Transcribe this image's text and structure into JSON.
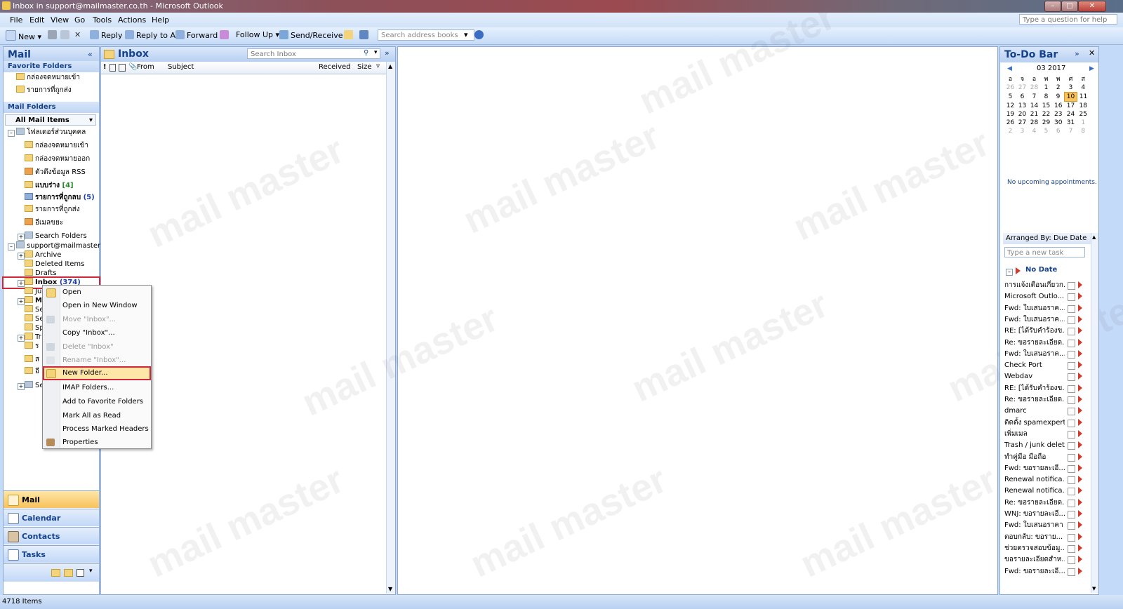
{
  "window": {
    "title": "Inbox in support@mailmaster.co.th - Microsoft Outlook"
  },
  "menu": [
    "File",
    "Edit",
    "View",
    "Go",
    "Tools",
    "Actions",
    "Help"
  ],
  "help_placeholder": "Type a question for help",
  "toolbar": {
    "new": "New",
    "reply": "Reply",
    "reply_all": "Reply to All",
    "forward": "Forward",
    "follow_up": "Follow Up",
    "send_receive": "Send/Receive",
    "address_search_placeholder": "Search address books"
  },
  "nav": {
    "header": "Mail",
    "favorite_header": "Favorite Folders",
    "favorites": [
      "กล่องจดหมายเข้า",
      "รายการที่ถูกส่ง"
    ],
    "mail_folders_header": "Mail Folders",
    "all_mail_items": "All Mail Items",
    "personal_root": "โฟลเดอร์ส่วนบุคคล",
    "personal_folders": [
      {
        "label": "กล่องจดหมายเข้า",
        "count": ""
      },
      {
        "label": "กล่องจดหมายออก",
        "count": ""
      },
      {
        "label": "ตัวดึงข้อมูล RSS",
        "count": ""
      },
      {
        "label": "แบบร่าง",
        "count": "[4]"
      },
      {
        "label": "รายการที่ถูกลบ",
        "count": "(5)"
      },
      {
        "label": "รายการที่ถูกส่ง",
        "count": ""
      },
      {
        "label": "อีเมลขยะ",
        "count": ""
      },
      {
        "label": "Search Folders",
        "count": ""
      }
    ],
    "account_root": "support@mailmaster.co",
    "account_folders": [
      "Archive",
      "Deleted Items",
      "Drafts"
    ],
    "inbox_label": "Inbox",
    "inbox_count": "(374)",
    "hidden_folders": [
      "Ju",
      "M",
      "Se",
      "Se",
      "Sp",
      "Tr",
      "ร",
      "ส",
      "อี",
      "Se"
    ],
    "buttons": [
      "Mail",
      "Calendar",
      "Contacts",
      "Tasks"
    ]
  },
  "list": {
    "title": "Inbox",
    "search_placeholder": "Search Inbox",
    "columns": [
      "From",
      "Subject",
      "Received",
      "Size"
    ]
  },
  "context_menu": [
    {
      "label": "Open",
      "disabled": false
    },
    {
      "label": "Open in New Window",
      "disabled": false
    },
    {
      "label": "Move \"Inbox\"...",
      "disabled": true
    },
    {
      "label": "Copy \"Inbox\"...",
      "disabled": false
    },
    {
      "label": "Delete \"Inbox\"",
      "disabled": true
    },
    {
      "label": "Rename \"Inbox\"...",
      "disabled": true
    },
    {
      "label": "New Folder...",
      "disabled": false,
      "highlighted": true
    },
    {
      "label": "IMAP Folders...",
      "disabled": false
    },
    {
      "label": "Add to Favorite Folders",
      "disabled": false
    },
    {
      "label": "Mark All as Read",
      "disabled": false
    },
    {
      "label": "Process Marked Headers",
      "disabled": false
    },
    {
      "label": "Properties",
      "disabled": false
    }
  ],
  "todo": {
    "title": "To-Do Bar",
    "calendar_month": "03 2017",
    "weekdays": [
      "อ",
      "จ",
      "อ",
      "พ",
      "พ",
      "ศ",
      "ส"
    ],
    "weeks": [
      [
        "26",
        "27",
        "28",
        "1",
        "2",
        "3",
        "4"
      ],
      [
        "5",
        "6",
        "7",
        "8",
        "9",
        "10",
        "11"
      ],
      [
        "12",
        "13",
        "14",
        "15",
        "16",
        "17",
        "18"
      ],
      [
        "19",
        "20",
        "21",
        "22",
        "23",
        "24",
        "25"
      ],
      [
        "26",
        "27",
        "28",
        "29",
        "30",
        "31",
        "1"
      ],
      [
        "2",
        "3",
        "4",
        "5",
        "6",
        "7",
        "8"
      ]
    ],
    "no_appointments": "No upcoming appointments.",
    "arranged_by": "Arranged By: Due Date",
    "new_task_placeholder": "Type a new task",
    "group": "No Date",
    "tasks": [
      "การแจ้งเตือนเกี่ยวก...",
      "Microsoft Outlo...",
      "Fwd: ใบเสนอราค...",
      "Fwd: ใบเสนอราค...",
      "RE: [ได้รับคำร้องข...",
      "Re: ขอรายละเอียด...",
      "Fwd: ใบเสนอราค...",
      "Check Port",
      "Webdav",
      "RE: [ได้รับคำร้องข...",
      "Re: ขอรายละเอียด...",
      "dmarc",
      "ติดตั้ง spamexpert",
      "เพิ่มเมล",
      "Trash / junk delete",
      "ทำคู่มือ มือถือ",
      "Fwd: ขอรายละเอี...",
      "Renewal notifica...",
      "Renewal notifica...",
      "Re: ขอรายละเอียด...",
      "WNJ: ขอรายละเอี...",
      "Fwd: ใบเสนอราคา",
      "ตอบกลับ: ขอราย...",
      "ช่วยตรวจสอบข้อมู...",
      "ขอรายละเอียดสำห...",
      "Fwd: ขอรายละเอี..."
    ]
  },
  "status": {
    "items": "4718 Items"
  },
  "watermark": "mail master",
  "colors": {
    "accent": "#15428b",
    "highlight": "#f9c25c",
    "red_box": "#d0283a"
  }
}
